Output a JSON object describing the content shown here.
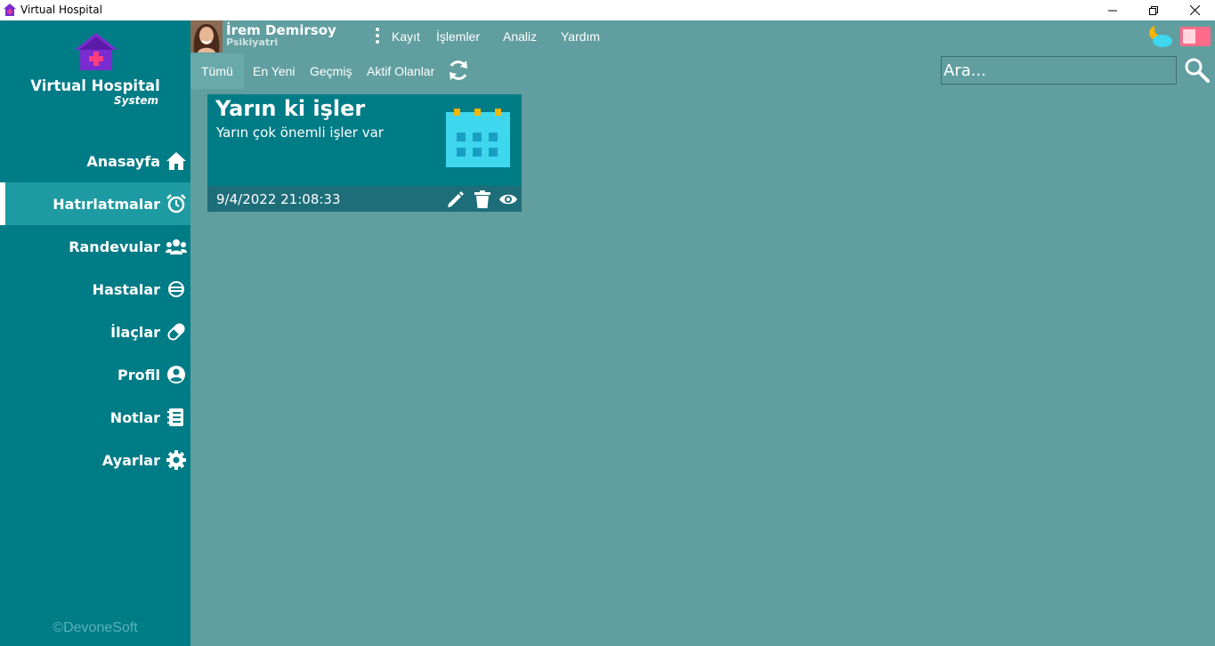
{
  "window": {
    "title": "Virtual Hospital"
  },
  "sidebar": {
    "brand": "Virtual Hospital",
    "brand_sub": "System",
    "items": [
      {
        "label": "Anasayfa",
        "icon": "home-icon"
      },
      {
        "label": "Hatırlatmalar",
        "icon": "alarm-clock-icon",
        "active": true
      },
      {
        "label": "Randevular",
        "icon": "people-icon"
      },
      {
        "label": "Hastalar",
        "icon": "patient-icon"
      },
      {
        "label": "İlaçlar",
        "icon": "pill-icon"
      },
      {
        "label": "Profil",
        "icon": "account-circle-icon"
      },
      {
        "label": "Notlar",
        "icon": "notebook-icon"
      },
      {
        "label": "Ayarlar",
        "icon": "gear-icon"
      }
    ],
    "copyright": "©DevoneSoft"
  },
  "header": {
    "user_name": "İrem Demirsoy",
    "user_role": "Psikiyatri",
    "menu": [
      "Kayıt",
      "İşlemler",
      "Analiz",
      "Yardım"
    ]
  },
  "tabs": [
    "Tümü",
    "En Yeni",
    "Geçmiş",
    "Aktif Olanlar"
  ],
  "active_tab": "Tümü",
  "search": {
    "placeholder": "Ara..."
  },
  "reminders": [
    {
      "title": "Yarın ki işler",
      "description": "Yarın çok önemli işler var",
      "datetime": "9/4/2022 21:08:33"
    }
  ],
  "colors": {
    "sidebar_bg": "#007c86",
    "sidebar_active": "#1e9aa2",
    "main_bg": "#619e9f",
    "card_bg": "#007c86",
    "card_footer": "#1e6e7a",
    "calendar": "#3ed7ee",
    "calendar_rings": "#f7b500"
  }
}
